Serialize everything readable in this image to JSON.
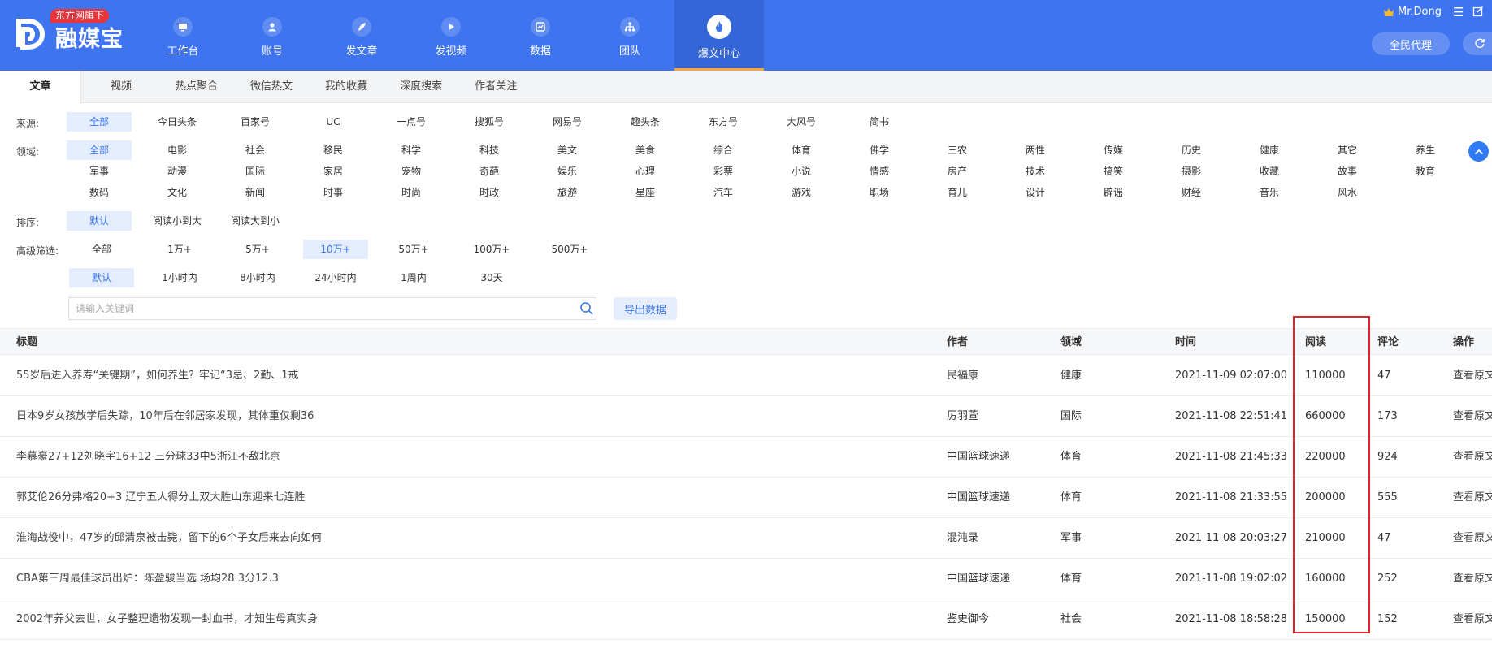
{
  "header": {
    "logo_text": "融媒宝",
    "badge": "东方网旗下",
    "nav": [
      {
        "label": "工作台",
        "icon": "monitor-icon"
      },
      {
        "label": "账号",
        "icon": "user-icon"
      },
      {
        "label": "发文章",
        "icon": "feather-icon"
      },
      {
        "label": "发视频",
        "icon": "play-icon"
      },
      {
        "label": "数据",
        "icon": "chart-icon"
      },
      {
        "label": "团队",
        "icon": "org-icon"
      },
      {
        "label": "爆文中心",
        "icon": "flame-icon",
        "active": true
      }
    ],
    "user_name": "Mr.Dong",
    "menu_glyph": "☰",
    "agent_button": "全民代理"
  },
  "tabs": [
    {
      "label": "文章",
      "active": true
    },
    {
      "label": "视频"
    },
    {
      "label": "热点聚合"
    },
    {
      "label": "微信热文"
    },
    {
      "label": "我的收藏"
    },
    {
      "label": "深度搜索"
    },
    {
      "label": "作者关注"
    }
  ],
  "filters": {
    "source": {
      "label": "来源:",
      "options": [
        "全部",
        "今日头条",
        "百家号",
        "UC",
        "一点号",
        "搜狐号",
        "网易号",
        "趣头条",
        "东方号",
        "大风号",
        "简书"
      ],
      "selected": "全部"
    },
    "domain": {
      "label": "领域:",
      "rows": [
        [
          "全部",
          "电影",
          "社会",
          "移民",
          "科学",
          "科技",
          "美文",
          "美食",
          "综合",
          "体育",
          "佛学",
          "三农",
          "两性",
          "传媒",
          "历史",
          "健康",
          "其它",
          "养生"
        ],
        [
          "军事",
          "动漫",
          "国际",
          "家居",
          "宠物",
          "奇葩",
          "娱乐",
          "心理",
          "彩票",
          "小说",
          "情感",
          "房产",
          "技术",
          "搞笑",
          "摄影",
          "收藏",
          "故事",
          "教育"
        ],
        [
          "数码",
          "文化",
          "新闻",
          "时事",
          "时尚",
          "时政",
          "旅游",
          "星座",
          "汽车",
          "游戏",
          "职场",
          "育儿",
          "设计",
          "辟谣",
          "财经",
          "音乐",
          "风水"
        ]
      ],
      "selected": "全部"
    },
    "sort": {
      "label": "排序:",
      "options": [
        "默认",
        "阅读小到大",
        "阅读大到小"
      ],
      "selected": "默认"
    },
    "advanced": {
      "label": "高级筛选:",
      "reads": [
        "全部",
        "1万+",
        "5万+",
        "10万+",
        "50万+",
        "100万+",
        "500万+"
      ],
      "reads_selected": "10万+",
      "times": [
        "默认",
        "1小时内",
        "8小时内",
        "24小时内",
        "1周内",
        "30天"
      ],
      "times_selected": "默认"
    }
  },
  "search": {
    "placeholder": "请输入关键词",
    "value": "",
    "export_button": "导出数据"
  },
  "table": {
    "headers": {
      "title": "标题",
      "author": "作者",
      "domain": "领域",
      "time": "时间",
      "reads": "阅读",
      "comments": "评论",
      "op": "操作"
    },
    "rows": [
      {
        "title": "55岁后进入养寿“关键期”，如何养生？牢记“3忌、2勤、1戒",
        "author": "民福康",
        "domain": "健康",
        "time": "2021-11-09 02:07:00",
        "reads": "110000",
        "comments": "47",
        "op": "查看原文"
      },
      {
        "title": "日本9岁女孩放学后失踪，10年后在邻居家发现，其体重仅剩36",
        "author": "厉羽萱",
        "domain": "国际",
        "time": "2021-11-08 22:51:41",
        "reads": "660000",
        "comments": "173",
        "op": "查看原文"
      },
      {
        "title": "李慕豪27+12刘晓宇16+12 三分球33中5浙江不敌北京",
        "author": "中国篮球速递",
        "domain": "体育",
        "time": "2021-11-08 21:45:33",
        "reads": "220000",
        "comments": "924",
        "op": "查看原文"
      },
      {
        "title": "郭艾伦26分弗格20+3 辽宁五人得分上双大胜山东迎来七连胜",
        "author": "中国篮球速递",
        "domain": "体育",
        "time": "2021-11-08 21:33:55",
        "reads": "200000",
        "comments": "555",
        "op": "查看原文"
      },
      {
        "title": "淮海战役中，47岁的邱清泉被击毙，留下的6个子女后来去向如何",
        "author": "混沌录",
        "domain": "军事",
        "time": "2021-11-08 20:03:27",
        "reads": "210000",
        "comments": "47",
        "op": "查看原文"
      },
      {
        "title": "CBA第三周最佳球员出炉：陈盈骏当选 场均28.3分12.3",
        "author": "中国篮球速递",
        "domain": "体育",
        "time": "2021-11-08 19:02:02",
        "reads": "160000",
        "comments": "252",
        "op": "查看原文"
      },
      {
        "title": "2002年养父去世，女子整理遗物发现一封血书，才知生母真实身",
        "author": "鉴史御今",
        "domain": "社会",
        "time": "2021-11-08 18:58:28",
        "reads": "150000",
        "comments": "152",
        "op": "查看原文"
      }
    ]
  },
  "colors": {
    "header_bg": "#3f74f0",
    "nav_active_bg": "#3566d8",
    "nav_active_underline": "#f5a343",
    "badge_bg": "#e8353b",
    "chip_active_bg": "#e4edfd",
    "chip_active_text": "#3a75ee",
    "highlight": "#e0242b"
  }
}
